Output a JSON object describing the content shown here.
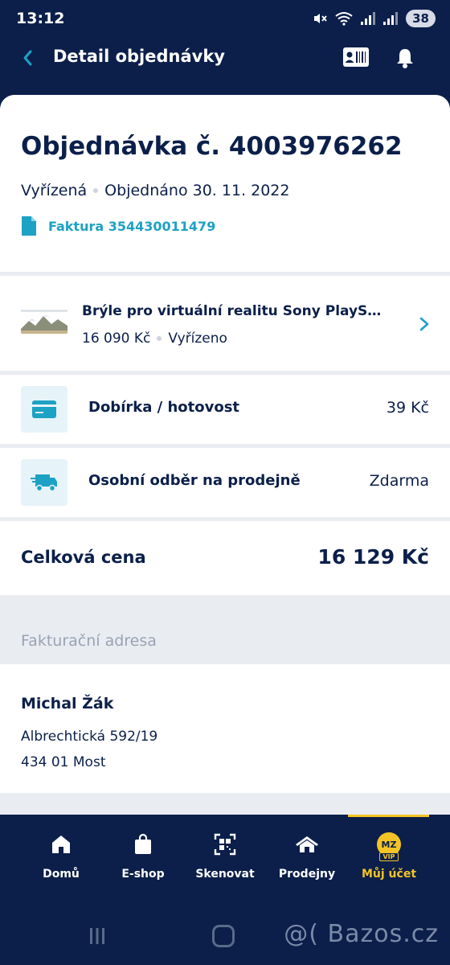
{
  "status_bar": {
    "time": "13:12",
    "battery": "38"
  },
  "header": {
    "title": "Detail objednávky"
  },
  "order": {
    "title": "Objednávka č. 4003976262",
    "status": "Vyřízená",
    "ordered": "Objednáno 30. 11. 2022",
    "invoice": "Faktura 354430011479"
  },
  "product": {
    "name": "Brýle pro virtuální realitu Sony PlayStation",
    "price": "16 090 Kč",
    "status": "Vyřízeno"
  },
  "payment": {
    "label": "Dobírka / hotovost",
    "value": "39 Kč"
  },
  "shipping": {
    "label": "Osobní odběr na prodejně",
    "value": "Zdarma"
  },
  "total": {
    "label": "Celková cena",
    "value": "16 129 Kč"
  },
  "billing": {
    "heading": "Fakturační adresa",
    "name": "Michal Žák",
    "street": "Albrechtická 592/19",
    "city": "434 01 Most"
  },
  "nav": {
    "items": [
      {
        "label": "Domů",
        "icon": "home-icon"
      },
      {
        "label": "E-shop",
        "icon": "shopping-bag-icon"
      },
      {
        "label": "Skenovat",
        "icon": "qr-scan-icon"
      },
      {
        "label": "Prodejny",
        "icon": "store-icon"
      },
      {
        "label": "Můj účet",
        "icon": "mz-vip-badge-icon"
      }
    ],
    "badge_text": "MZ",
    "badge_sub": "VIP"
  },
  "watermark": "@( Bazos.cz",
  "colors": {
    "navy": "#0b1f4a",
    "accent": "#1da1c4",
    "active": "#f3c425"
  }
}
